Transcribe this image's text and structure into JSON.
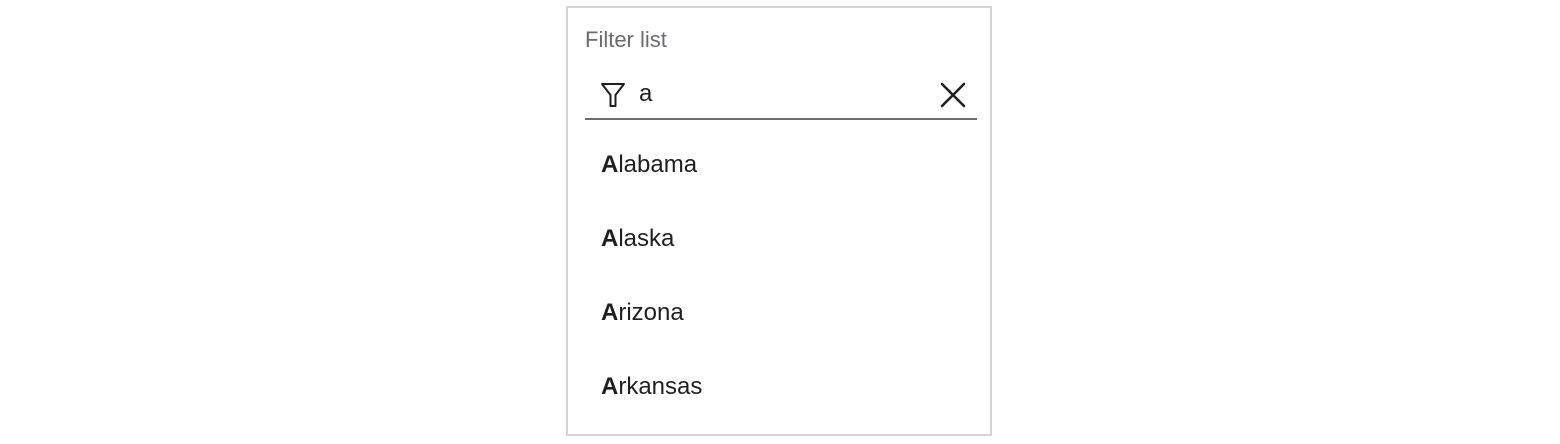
{
  "filter": {
    "label": "Filter list",
    "query": "a",
    "filter_icon": "filter-funnel-icon",
    "clear_icon": "close-icon"
  },
  "items": [
    {
      "match": "A",
      "rest": "labama"
    },
    {
      "match": "A",
      "rest": "laska"
    },
    {
      "match": "A",
      "rest": "rizona"
    },
    {
      "match": "A",
      "rest": "rkansas"
    }
  ]
}
